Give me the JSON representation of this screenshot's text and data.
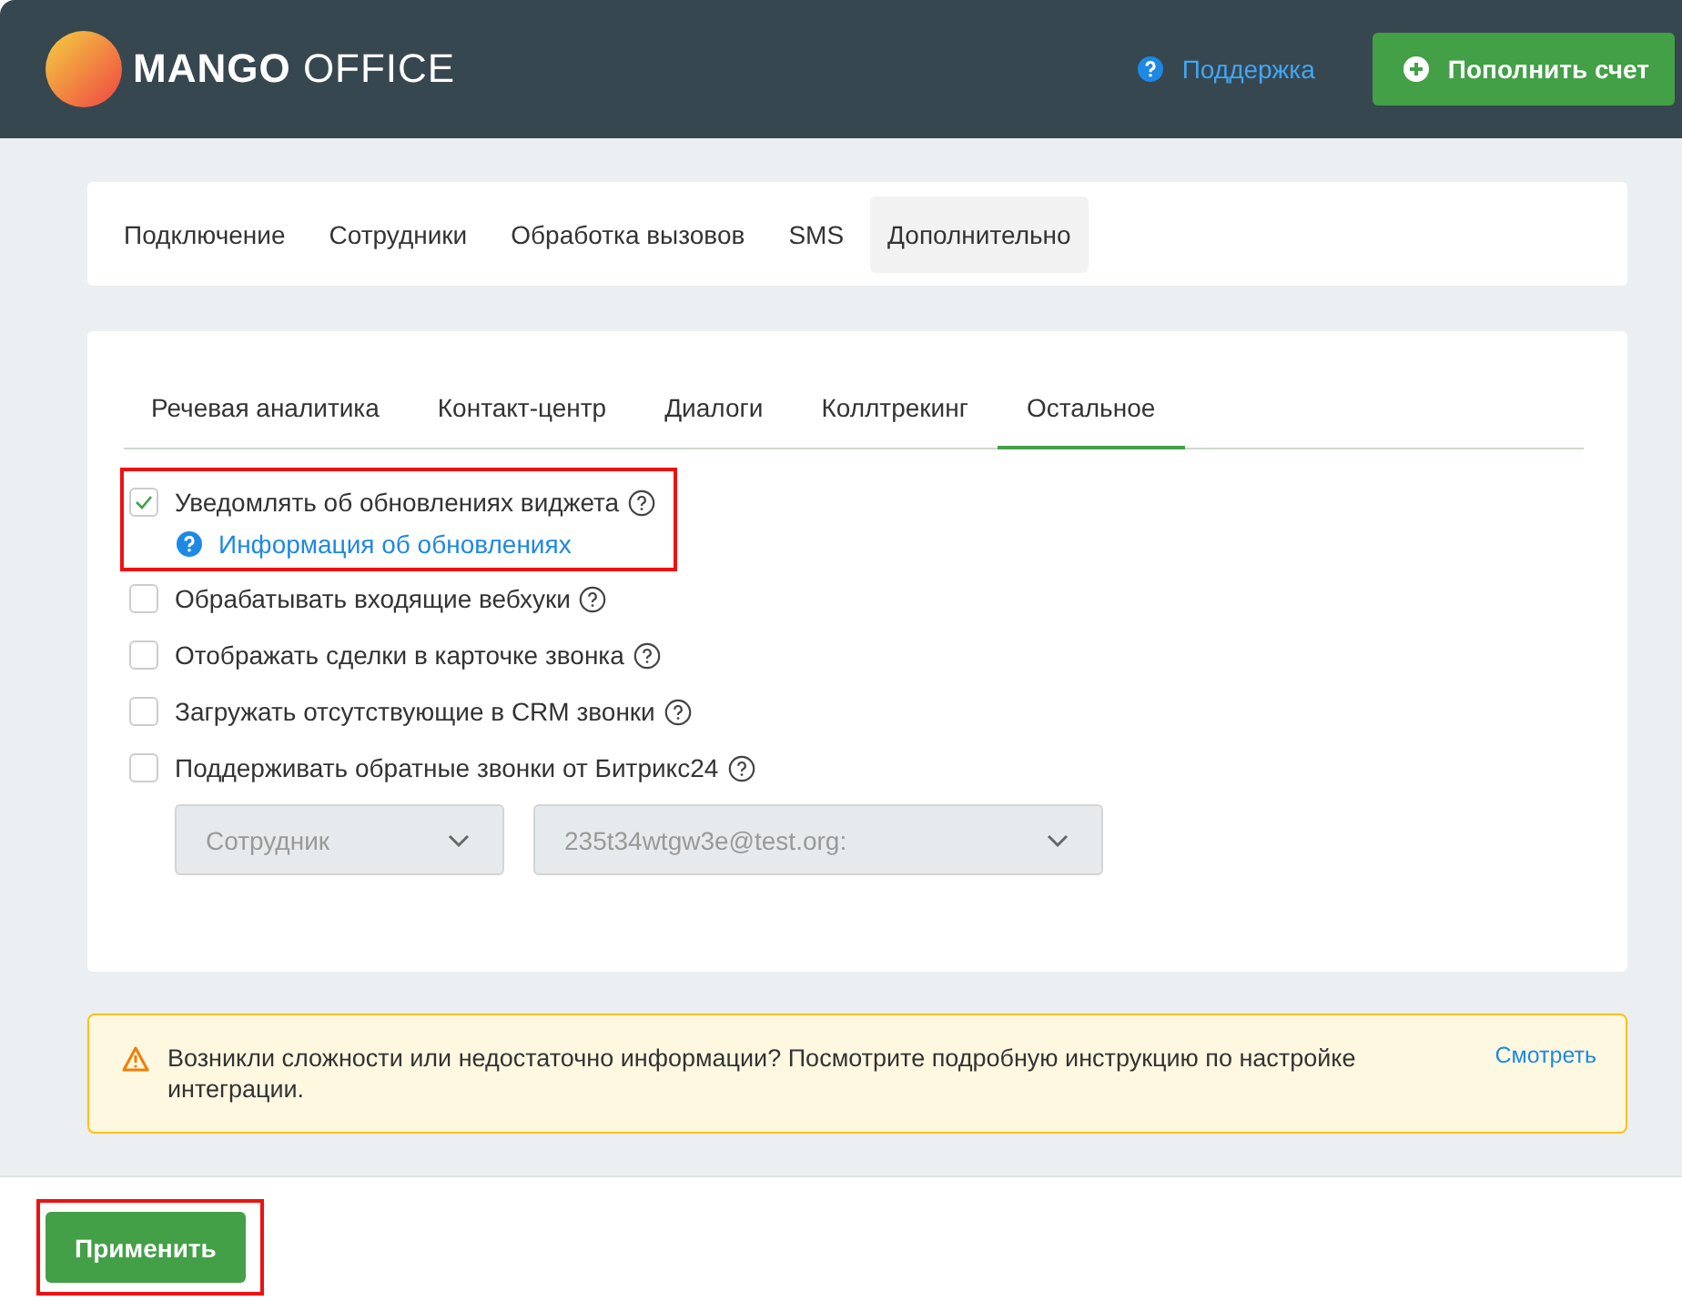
{
  "header": {
    "logo": {
      "bold": "MANGO",
      "light": "OFFICE"
    },
    "support_link": "Поддержка",
    "topup_button": "Пополнить счет"
  },
  "tabs": [
    {
      "label": "Подключение",
      "selected": false
    },
    {
      "label": "Сотрудники",
      "selected": false
    },
    {
      "label": "Обработка вызовов",
      "selected": false
    },
    {
      "label": "SMS",
      "selected": false
    },
    {
      "label": "Дополнительно",
      "selected": true
    }
  ],
  "subtabs": [
    {
      "label": "Речевая аналитика",
      "selected": false
    },
    {
      "label": "Контакт-центр",
      "selected": false
    },
    {
      "label": "Диалоги",
      "selected": false
    },
    {
      "label": "Коллтрекинг",
      "selected": false
    },
    {
      "label": "Остальное",
      "selected": true
    }
  ],
  "options": [
    {
      "label": "Уведомлять об обновлениях виджета",
      "checked": true,
      "highlighted": true,
      "info_link": "Информация об обновлениях"
    },
    {
      "label": "Обрабатывать входящие вебхуки",
      "checked": false,
      "highlighted": false
    },
    {
      "label": "Отображать сделки в карточке звонка",
      "checked": false,
      "highlighted": false
    },
    {
      "label": "Загружать отсутствующие в CRM звонки",
      "checked": false,
      "highlighted": false
    },
    {
      "label": "Поддерживать обратные звонки от Битрикс24",
      "checked": false,
      "highlighted": false
    }
  ],
  "selects": [
    {
      "value": "Сотрудник",
      "disabled": true
    },
    {
      "value": "235t34wtgw3e@test.org:",
      "disabled": true
    }
  ],
  "alert": {
    "text": "Возникли сложности или недостаточно информации? Посмотрите подробную инструкцию по настройке интеграции.",
    "link": "Смотреть"
  },
  "apply_button": {
    "label": "Применить",
    "highlighted": true
  }
}
